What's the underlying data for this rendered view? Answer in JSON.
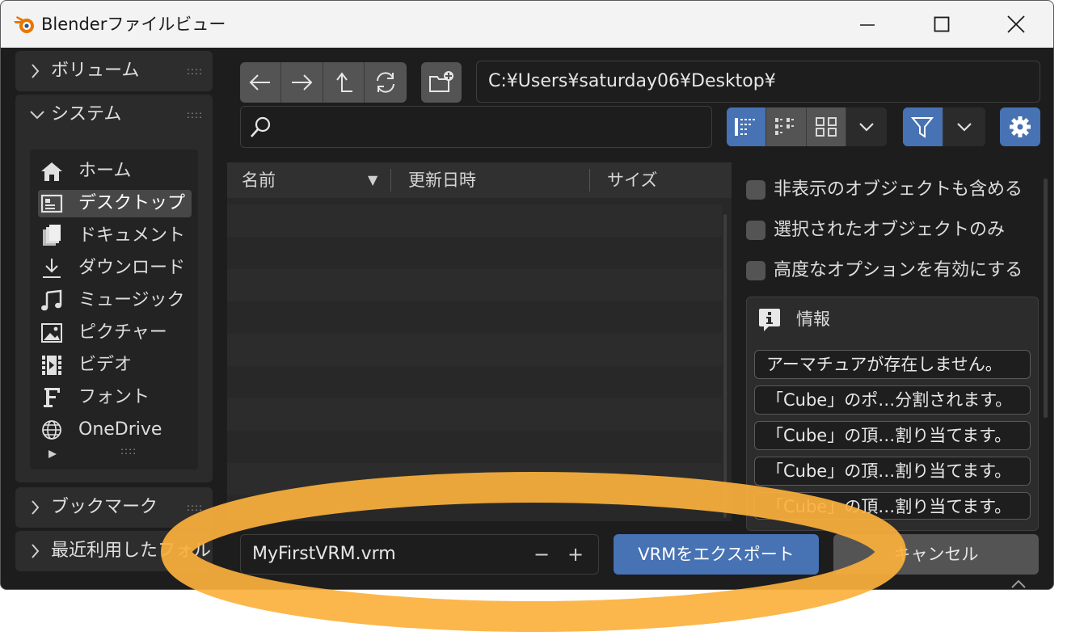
{
  "window": {
    "title": "Blenderファイルビュー",
    "icons": {
      "logo": "blender-logo-icon",
      "minimize": "minimize-icon",
      "maximize": "maximize-icon",
      "close": "close-icon"
    }
  },
  "sidebar": {
    "volumes_label": "ボリューム",
    "system_label": "システム",
    "system_items": [
      {
        "label": "ホーム",
        "icon": "home-icon"
      },
      {
        "label": "デスクトップ",
        "icon": "desktop-icon"
      },
      {
        "label": "ドキュメント",
        "icon": "documents-icon"
      },
      {
        "label": "ダウンロード",
        "icon": "download-icon"
      },
      {
        "label": "ミュージック",
        "icon": "music-icon"
      },
      {
        "label": "ピクチャー",
        "icon": "picture-icon"
      },
      {
        "label": "ビデオ",
        "icon": "video-icon"
      },
      {
        "label": "フォント",
        "icon": "font-icon"
      },
      {
        "label": "OneDrive",
        "icon": "globe-icon"
      }
    ],
    "bookmarks_label": "ブックマーク",
    "recent_label": "最近利用したフォル",
    "grip": "::::",
    "list_grip": "::::"
  },
  "toolbar": {
    "path": "C:¥Users¥saturday06¥Desktop¥",
    "search_value": "",
    "nav_icons": [
      "back-arrow-icon",
      "forward-arrow-icon",
      "parent-dir-icon",
      "refresh-icon"
    ],
    "new_folder_icon": "new-folder-icon",
    "view_icons": [
      "list-vertical-icon",
      "list-horizontal-icon",
      "thumbnails-icon",
      "chevron-down-icon"
    ],
    "filter_icon": "filter-icon",
    "settings_icon": "gear-icon"
  },
  "file_list": {
    "columns": [
      "名前",
      "更新日時",
      "サイズ"
    ],
    "sort_indicator": "▼",
    "rows": []
  },
  "options": {
    "items": [
      {
        "label": "非表示のオブジェクトも含める",
        "checked": false
      },
      {
        "label": "選択されたオブジェクトのみ",
        "checked": false
      },
      {
        "label": "高度なオプションを有効にする",
        "checked": false
      }
    ],
    "info_title": "情報",
    "messages": [
      "アーマチュアが存在しません。",
      "「Cube」のポ…分割されます。",
      "「Cube」の頂…割り当てます。",
      "「Cube」の頂…割り当てます。",
      "「Cube」の頂…割り当てます。"
    ]
  },
  "footer": {
    "filename": "MyFirstVRM.vrm",
    "decrement": "−",
    "increment": "+",
    "export_label": "VRMをエクスポート",
    "cancel_label": "キャンセル"
  },
  "colors": {
    "accent": "#4772b3",
    "highlight_ring": "#fbb13c"
  }
}
